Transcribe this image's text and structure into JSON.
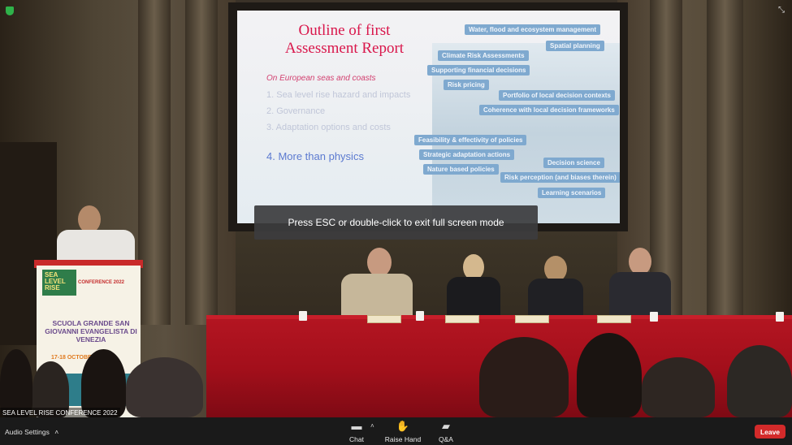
{
  "slide": {
    "title_line1": "Outline of first",
    "title_line2": "Assessment Report",
    "subtitle": "On European seas and coasts",
    "line_1": "1. Sea level rise hazard and impacts",
    "line_2": "2. Governance",
    "line_3": "3. Adaptation options and costs",
    "highlight": "4. More than physics",
    "chips": [
      "Water, flood and ecosystem management",
      "Spatial planning",
      "Climate Risk Assessments",
      "Supporting financial decisions",
      "Risk pricing",
      "Portfolio of local decision contexts",
      "Coherence with local decision frameworks",
      "Feasibility & effectivity of policies",
      "Strategic adaptation actions",
      "Nature based policies",
      "Decision science",
      "Risk perception (and biases therein)",
      "Learning scenarios"
    ]
  },
  "fullscreen_banner": "Press ESC or double-click to exit full screen mode",
  "podium": {
    "logo": "SEA LEVEL RISE",
    "conference": "CONFERENCE 2022",
    "venue": "SCUOLA GRANDE SAN GIOVANNI EVANGELISTA DI VENEZIA",
    "dates": "17-18 OCTOBER"
  },
  "caption": "SEA LEVEL RISE CONFERENCE 2022",
  "toolbar": {
    "audio_settings": "Audio Settings",
    "chat": "Chat",
    "raise_hand": "Raise Hand",
    "qa": "Q&A",
    "leave": "Leave"
  },
  "icons": {
    "security": "shield-icon",
    "exit_fullscreen": "exit-fullscreen-icon",
    "chat": "chat-bubble-icon",
    "raise_hand": "hand-icon",
    "qa": "qa-bubbles-icon",
    "chevron": "chevron-up-icon"
  },
  "colors": {
    "leave": "#d32a2a",
    "slide_title": "#d9164b",
    "chip": "#7fa9cf",
    "table": "#b31521",
    "secure": "#2fb24a"
  }
}
